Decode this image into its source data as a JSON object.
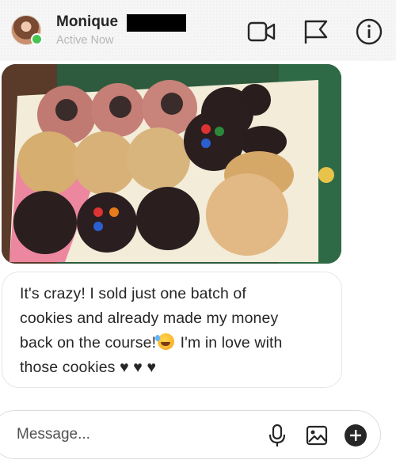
{
  "header": {
    "name": "Monique",
    "status": "Active Now",
    "icons": [
      "video-call-icon",
      "flag-icon",
      "info-icon"
    ]
  },
  "conversation": {
    "image_description_icon": "cookies-photo",
    "message_lines": [
      "It's crazy! I sold just one batch of",
      "cookies and already made my money",
      "back on the course!",
      " I'm in love with",
      "those cookies ",
      "♥  ♥  ♥"
    ],
    "emoji": "rofl-emoji"
  },
  "composer": {
    "placeholder": "Message...",
    "icons": [
      "microphone-icon",
      "gallery-icon",
      "add-icon"
    ]
  },
  "colors": {
    "presence": "#44c553",
    "text": "#262626",
    "muted": "#b5b5b5",
    "border": "#e6e6e6"
  }
}
